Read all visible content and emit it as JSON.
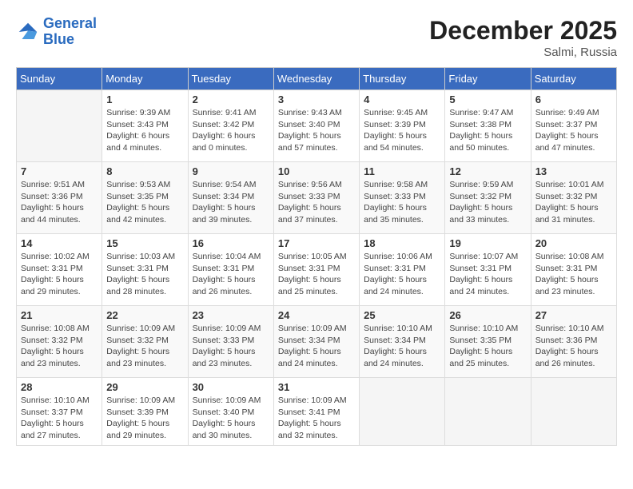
{
  "header": {
    "logo_line1": "General",
    "logo_line2": "Blue",
    "month_year": "December 2025",
    "location": "Salmi, Russia"
  },
  "weekdays": [
    "Sunday",
    "Monday",
    "Tuesday",
    "Wednesday",
    "Thursday",
    "Friday",
    "Saturday"
  ],
  "weeks": [
    [
      {
        "day": "",
        "detail": ""
      },
      {
        "day": "1",
        "detail": "Sunrise: 9:39 AM\nSunset: 3:43 PM\nDaylight: 6 hours\nand 4 minutes."
      },
      {
        "day": "2",
        "detail": "Sunrise: 9:41 AM\nSunset: 3:42 PM\nDaylight: 6 hours\nand 0 minutes."
      },
      {
        "day": "3",
        "detail": "Sunrise: 9:43 AM\nSunset: 3:40 PM\nDaylight: 5 hours\nand 57 minutes."
      },
      {
        "day": "4",
        "detail": "Sunrise: 9:45 AM\nSunset: 3:39 PM\nDaylight: 5 hours\nand 54 minutes."
      },
      {
        "day": "5",
        "detail": "Sunrise: 9:47 AM\nSunset: 3:38 PM\nDaylight: 5 hours\nand 50 minutes."
      },
      {
        "day": "6",
        "detail": "Sunrise: 9:49 AM\nSunset: 3:37 PM\nDaylight: 5 hours\nand 47 minutes."
      }
    ],
    [
      {
        "day": "7",
        "detail": "Sunrise: 9:51 AM\nSunset: 3:36 PM\nDaylight: 5 hours\nand 44 minutes."
      },
      {
        "day": "8",
        "detail": "Sunrise: 9:53 AM\nSunset: 3:35 PM\nDaylight: 5 hours\nand 42 minutes."
      },
      {
        "day": "9",
        "detail": "Sunrise: 9:54 AM\nSunset: 3:34 PM\nDaylight: 5 hours\nand 39 minutes."
      },
      {
        "day": "10",
        "detail": "Sunrise: 9:56 AM\nSunset: 3:33 PM\nDaylight: 5 hours\nand 37 minutes."
      },
      {
        "day": "11",
        "detail": "Sunrise: 9:58 AM\nSunset: 3:33 PM\nDaylight: 5 hours\nand 35 minutes."
      },
      {
        "day": "12",
        "detail": "Sunrise: 9:59 AM\nSunset: 3:32 PM\nDaylight: 5 hours\nand 33 minutes."
      },
      {
        "day": "13",
        "detail": "Sunrise: 10:01 AM\nSunset: 3:32 PM\nDaylight: 5 hours\nand 31 minutes."
      }
    ],
    [
      {
        "day": "14",
        "detail": "Sunrise: 10:02 AM\nSunset: 3:31 PM\nDaylight: 5 hours\nand 29 minutes."
      },
      {
        "day": "15",
        "detail": "Sunrise: 10:03 AM\nSunset: 3:31 PM\nDaylight: 5 hours\nand 28 minutes."
      },
      {
        "day": "16",
        "detail": "Sunrise: 10:04 AM\nSunset: 3:31 PM\nDaylight: 5 hours\nand 26 minutes."
      },
      {
        "day": "17",
        "detail": "Sunrise: 10:05 AM\nSunset: 3:31 PM\nDaylight: 5 hours\nand 25 minutes."
      },
      {
        "day": "18",
        "detail": "Sunrise: 10:06 AM\nSunset: 3:31 PM\nDaylight: 5 hours\nand 24 minutes."
      },
      {
        "day": "19",
        "detail": "Sunrise: 10:07 AM\nSunset: 3:31 PM\nDaylight: 5 hours\nand 24 minutes."
      },
      {
        "day": "20",
        "detail": "Sunrise: 10:08 AM\nSunset: 3:31 PM\nDaylight: 5 hours\nand 23 minutes."
      }
    ],
    [
      {
        "day": "21",
        "detail": "Sunrise: 10:08 AM\nSunset: 3:32 PM\nDaylight: 5 hours\nand 23 minutes."
      },
      {
        "day": "22",
        "detail": "Sunrise: 10:09 AM\nSunset: 3:32 PM\nDaylight: 5 hours\nand 23 minutes."
      },
      {
        "day": "23",
        "detail": "Sunrise: 10:09 AM\nSunset: 3:33 PM\nDaylight: 5 hours\nand 23 minutes."
      },
      {
        "day": "24",
        "detail": "Sunrise: 10:09 AM\nSunset: 3:34 PM\nDaylight: 5 hours\nand 24 minutes."
      },
      {
        "day": "25",
        "detail": "Sunrise: 10:10 AM\nSunset: 3:34 PM\nDaylight: 5 hours\nand 24 minutes."
      },
      {
        "day": "26",
        "detail": "Sunrise: 10:10 AM\nSunset: 3:35 PM\nDaylight: 5 hours\nand 25 minutes."
      },
      {
        "day": "27",
        "detail": "Sunrise: 10:10 AM\nSunset: 3:36 PM\nDaylight: 5 hours\nand 26 minutes."
      }
    ],
    [
      {
        "day": "28",
        "detail": "Sunrise: 10:10 AM\nSunset: 3:37 PM\nDaylight: 5 hours\nand 27 minutes."
      },
      {
        "day": "29",
        "detail": "Sunrise: 10:09 AM\nSunset: 3:39 PM\nDaylight: 5 hours\nand 29 minutes."
      },
      {
        "day": "30",
        "detail": "Sunrise: 10:09 AM\nSunset: 3:40 PM\nDaylight: 5 hours\nand 30 minutes."
      },
      {
        "day": "31",
        "detail": "Sunrise: 10:09 AM\nSunset: 3:41 PM\nDaylight: 5 hours\nand 32 minutes."
      },
      {
        "day": "",
        "detail": ""
      },
      {
        "day": "",
        "detail": ""
      },
      {
        "day": "",
        "detail": ""
      }
    ]
  ]
}
